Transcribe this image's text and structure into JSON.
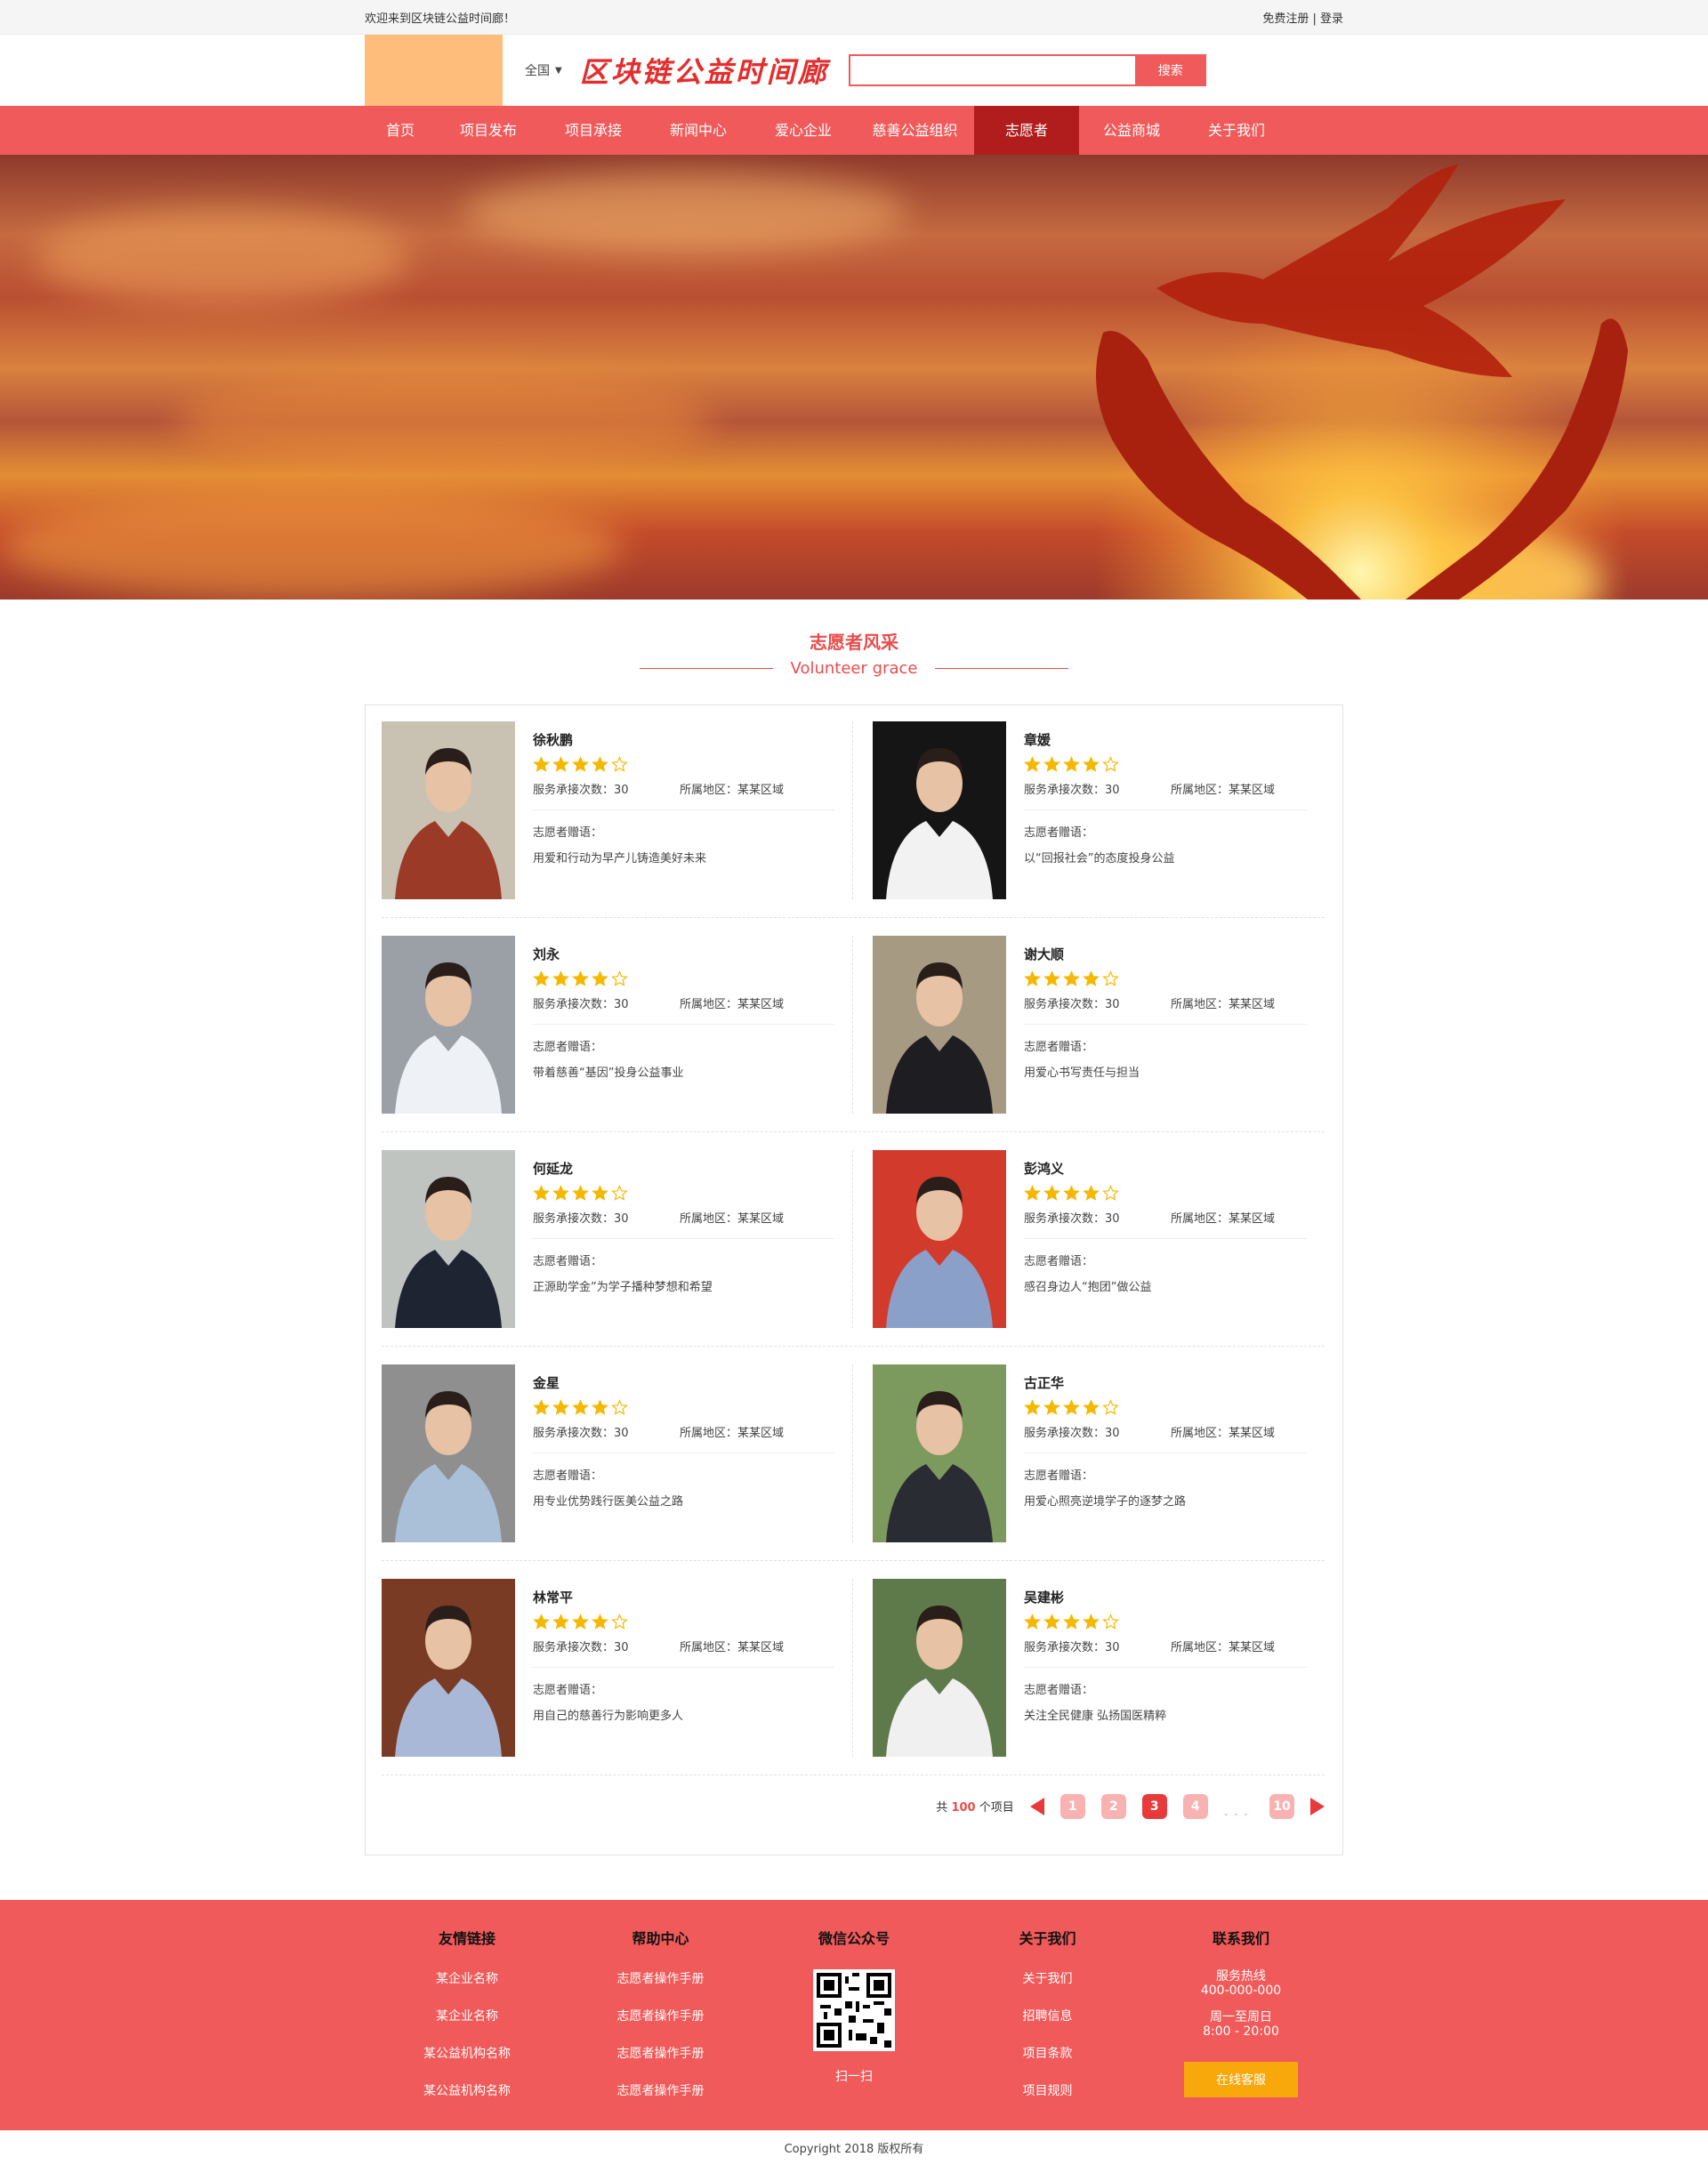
{
  "topbar": {
    "welcome": "欢迎来到区块链公益时间廊！",
    "register": "免费注册",
    "sep": " | ",
    "login": "登录"
  },
  "header": {
    "city": "全国",
    "brand": "区块链公益时间廊",
    "search_placeholder": "",
    "search_button": "搜索"
  },
  "nav": [
    {
      "label": "首页",
      "active": false
    },
    {
      "label": "项目发布",
      "active": false
    },
    {
      "label": "项目承接",
      "active": false
    },
    {
      "label": "新闻中心",
      "active": false
    },
    {
      "label": "爱心企业",
      "active": false
    },
    {
      "label": "慈善公益组织",
      "active": false
    },
    {
      "label": "志愿者",
      "active": true
    },
    {
      "label": "公益商城",
      "active": false
    },
    {
      "label": "关于我们",
      "active": false
    }
  ],
  "section": {
    "title_cn": "志愿者风采",
    "title_en": "Volunteer grace"
  },
  "volunteer_labels": {
    "service_prefix": "服务承接次数：",
    "region_prefix": "所属地区：",
    "motto_label": "志愿者赠语："
  },
  "volunteers": [
    {
      "name": "徐秋鹏",
      "stars": 4,
      "services": "30",
      "region": "某某区域",
      "motto": "用爱和行动为早产儿铸造美好未来",
      "bg": "#c9c2b2",
      "shirt": "#9b3a26"
    },
    {
      "name": "章媛",
      "stars": 4,
      "services": "30",
      "region": "某某区域",
      "motto": "以“回报社会”的态度投身公益",
      "bg": "#151515",
      "shirt": "#f2f2f2"
    },
    {
      "name": "刘永",
      "stars": 4,
      "services": "30",
      "region": "某某区域",
      "motto": "带着慈善“基因”投身公益事业",
      "bg": "#9aa0a6",
      "shirt": "#eef2f6"
    },
    {
      "name": "谢大顺",
      "stars": 4,
      "services": "30",
      "region": "某某区域",
      "motto": "用爱心书写责任与担当",
      "bg": "#a79a82",
      "shirt": "#1e1e22"
    },
    {
      "name": "何延龙",
      "stars": 4,
      "services": "30",
      "region": "某某区域",
      "motto": "正源助学金”为学子播种梦想和希望",
      "bg": "#bfc4c0",
      "shirt": "#1f2433"
    },
    {
      "name": "彭鸿义",
      "stars": 4,
      "services": "30",
      "region": "某某区域",
      "motto": "感召身边人“抱团”做公益",
      "bg": "#d23a2c",
      "shirt": "#8aa0c8"
    },
    {
      "name": "金星",
      "stars": 4,
      "services": "30",
      "region": "某某区域",
      "motto": "用专业优势践行医美公益之路",
      "bg": "#8f8f8f",
      "shirt": "#a9c0d8"
    },
    {
      "name": "古正华",
      "stars": 4,
      "services": "30",
      "region": "某某区域",
      "motto": "用爱心照亮逆境学子的逐梦之路",
      "bg": "#7c9a5e",
      "shirt": "#2a2c33"
    },
    {
      "name": "林常平",
      "stars": 4,
      "services": "30",
      "region": "某某区域",
      "motto": "用自己的慈善行为影响更多人",
      "bg": "#7a3b24",
      "shirt": "#a9b8d6"
    },
    {
      "name": "吴建彬",
      "stars": 4,
      "services": "30",
      "region": "某某区域",
      "motto": "关注全民健康 弘扬国医精粹",
      "bg": "#5f7a4a",
      "shirt": "#f0f0f0"
    }
  ],
  "pager": {
    "total_prefix": "共",
    "total": "100",
    "total_suffix": "个项目",
    "pages": [
      "1",
      "2",
      "3",
      "4",
      "10"
    ],
    "current": "3",
    "dots": "..."
  },
  "footer": {
    "cols": [
      {
        "title": "友情链接",
        "items": [
          "某企业名称",
          "某企业名称",
          "某公益机构名称",
          "某公益机构名称"
        ]
      },
      {
        "title": "帮助中心",
        "items": [
          "志愿者操作手册",
          "志愿者操作手册",
          "志愿者操作手册",
          "志愿者操作手册"
        ]
      },
      {
        "title": "微信公众号",
        "items": [
          "扫一扫"
        ]
      },
      {
        "title": "关于我们",
        "items": [
          "关于我们",
          "招聘信息",
          "项目条款",
          "项目规则"
        ]
      },
      {
        "title": "联系我们",
        "hotline_label": "服务热线",
        "hotline": "400-000-000",
        "hours_label": "周一至周日",
        "hours": "8:00 - 20:00",
        "service_button": "在线客服"
      }
    ],
    "copyright": "Copyright 2018 版权所有"
  },
  "colors": {
    "accent": "#f15a5a",
    "nav_active": "#b11c1c",
    "star": "#f5b800",
    "button_orange": "#f9a80b"
  }
}
